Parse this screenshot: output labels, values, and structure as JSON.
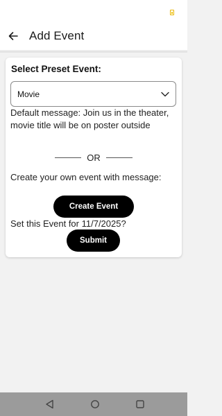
{
  "header": {
    "title": "Add Event"
  },
  "preset": {
    "section_title": "Select Preset Event:",
    "selected": "Movie"
  },
  "default_message": "Default message: Join us in the theater, movie title will be on poster outside",
  "or_label": "OR",
  "create_message": "Create your own event with message:",
  "create_button_label": "Create Event",
  "set_event_text": "Set this Event for 11/7/2025?",
  "submit_button_label": "Submit",
  "icons": {
    "back": "arrow-left-icon",
    "dropdown": "chevron-down-icon",
    "battery": "battery-icon",
    "nav_back": "triangle-back-icon",
    "nav_home": "circle-home-icon",
    "nav_recents": "square-recents-icon"
  },
  "colors": {
    "button_bg": "#000000",
    "button_text": "#ffffff",
    "background": "#f2f2f2",
    "nav_bar": "#9b9b9b"
  }
}
